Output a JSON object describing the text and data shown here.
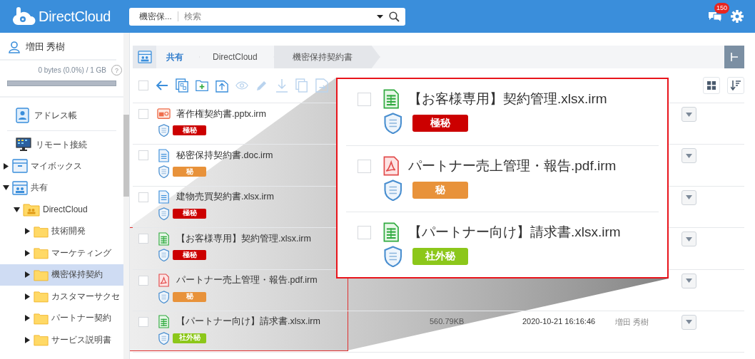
{
  "header": {
    "logo": "DirectCloud",
    "search": {
      "scope": "機密保...",
      "placeholder": "検索"
    },
    "notification_count": "150"
  },
  "sidebar": {
    "user": "増田 秀樹",
    "storage": {
      "text": "0 bytes (0.0%) / 1 GB",
      "help": "?",
      "level": 0
    },
    "nav": [
      {
        "label": "アドレス帳",
        "kind": "address"
      },
      {
        "label": "リモート接続",
        "kind": "remote"
      }
    ],
    "tree": [
      {
        "label": "マイボックス",
        "kind": "box",
        "expanded": false,
        "selected": false
      },
      {
        "label": "共有",
        "kind": "shared",
        "expanded": true,
        "selected": false,
        "children": [
          {
            "label": "DirectCloud",
            "kind": "team",
            "expanded": true,
            "selected": false,
            "children": [
              {
                "label": "技術開発",
                "kind": "folder",
                "expanded": false,
                "selected": false
              },
              {
                "label": "マーケティング",
                "kind": "folder",
                "expanded": false,
                "selected": false
              },
              {
                "label": "機密保持契約",
                "kind": "folder",
                "expanded": false,
                "selected": true
              },
              {
                "label": "カスタマーサクセ",
                "kind": "folder",
                "expanded": false,
                "selected": false
              },
              {
                "label": "パートナー契約",
                "kind": "folder",
                "expanded": false,
                "selected": false
              },
              {
                "label": "サービス説明書",
                "kind": "folder",
                "expanded": false,
                "selected": false
              }
            ]
          }
        ]
      }
    ]
  },
  "breadcrumb": [
    {
      "label": "共有",
      "selected": false
    },
    {
      "label": "DirectCloud",
      "selected": false
    },
    {
      "label": "機密保持契約書",
      "selected": true
    }
  ],
  "select_all": {
    "checked": false
  },
  "toolbar": [
    {
      "kind": "back",
      "disabled": false
    },
    {
      "kind": "copy",
      "disabled": false
    },
    {
      "kind": "new-folder",
      "disabled": false
    },
    {
      "kind": "upload",
      "disabled": false
    },
    {
      "kind": "preview",
      "disabled": true
    },
    {
      "kind": "rename",
      "disabled": true
    },
    {
      "kind": "download",
      "disabled": true
    },
    {
      "kind": "duplicate",
      "disabled": true
    },
    {
      "kind": "move",
      "disabled": true
    }
  ],
  "files": [
    {
      "name": "著作権契約書.pptx.irm",
      "kind": "slides",
      "checked": false,
      "tag": {
        "label": "極秘",
        "color": "#cc0000"
      }
    },
    {
      "name": "秘密保持契約書.doc.irm",
      "kind": "document",
      "checked": false,
      "tag": {
        "label": "秘",
        "color": "#e8923a"
      }
    },
    {
      "name": "建物売買契約書.xlsx.irm",
      "kind": "document",
      "checked": false,
      "tag": {
        "label": "極秘",
        "color": "#cc0000"
      }
    },
    {
      "name": "【お客様専用】契約管理.xlsx.irm",
      "kind": "sheet",
      "checked": false,
      "tag": {
        "label": "極秘",
        "color": "#cc0000"
      }
    },
    {
      "name": "パートナー売上管理・報告.pdf.irm",
      "kind": "pdf",
      "checked": false,
      "tag": {
        "label": "秘",
        "color": "#e8923a"
      }
    },
    {
      "name": "【パートナー向け】請求書.xlsx.irm",
      "kind": "sheet",
      "checked": false,
      "tag": {
        "label": "社外秘",
        "color": "#8cc71a"
      },
      "size": "560.79KB",
      "date": "2020-10-21 16:16:46",
      "owner": "増田 秀樹"
    }
  ],
  "callout": [
    {
      "name": "【お客様専用】契約管理.xlsx.irm",
      "kind": "sheet",
      "checked": false,
      "tag": {
        "label": "極秘",
        "color": "#cc0000"
      }
    },
    {
      "name": "パートナー売上管理・報告.pdf.irm",
      "kind": "pdf",
      "checked": false,
      "tag": {
        "label": "秘",
        "color": "#e8923a"
      }
    },
    {
      "name": "【パートナー向け】請求書.xlsx.irm",
      "kind": "sheet",
      "checked": false,
      "tag": {
        "label": "社外秘",
        "color": "#8cc71a"
      }
    }
  ]
}
